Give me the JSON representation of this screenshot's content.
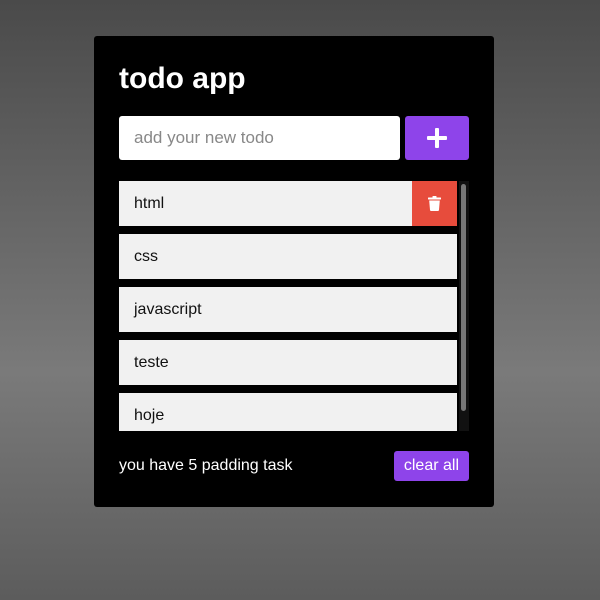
{
  "app": {
    "title": "todo app"
  },
  "input": {
    "placeholder": "add your new todo",
    "value": ""
  },
  "add_button": {
    "icon": "plus-icon"
  },
  "todos": [
    {
      "label": "html",
      "show_delete": true
    },
    {
      "label": "css",
      "show_delete": false
    },
    {
      "label": "javascript",
      "show_delete": false
    },
    {
      "label": "teste",
      "show_delete": false
    },
    {
      "label": "hoje",
      "show_delete": false
    }
  ],
  "footer": {
    "pending_prefix": "you have",
    "pending_count": "5",
    "pending_suffix": "padding task",
    "clear_label": "clear all"
  },
  "colors": {
    "accent": "#8e44ea",
    "delete": "#e74c3c",
    "item_bg": "#f1f1f1",
    "card_bg": "#000000"
  }
}
